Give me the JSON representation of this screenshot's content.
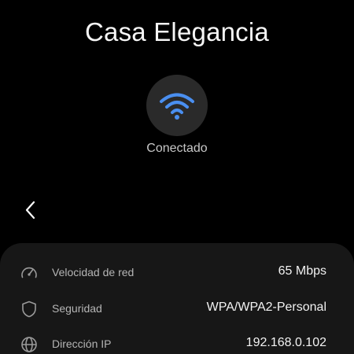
{
  "network": {
    "name": "Casa Elegancia",
    "status": "Conectado",
    "icon": "wifi-icon",
    "accent_color": "#4a8ff0"
  },
  "navigation": {
    "back_icon": "back-chevron-icon"
  },
  "details": [
    {
      "icon": "speedometer-icon",
      "label": "Velocidad de red",
      "value": "65 Mbps"
    },
    {
      "icon": "shield-icon",
      "label": "Seguridad",
      "value": "WPA/WPA2-Personal"
    },
    {
      "icon": "globe-icon",
      "label": "Dirección IP",
      "value": "192.168.0.102"
    }
  ]
}
